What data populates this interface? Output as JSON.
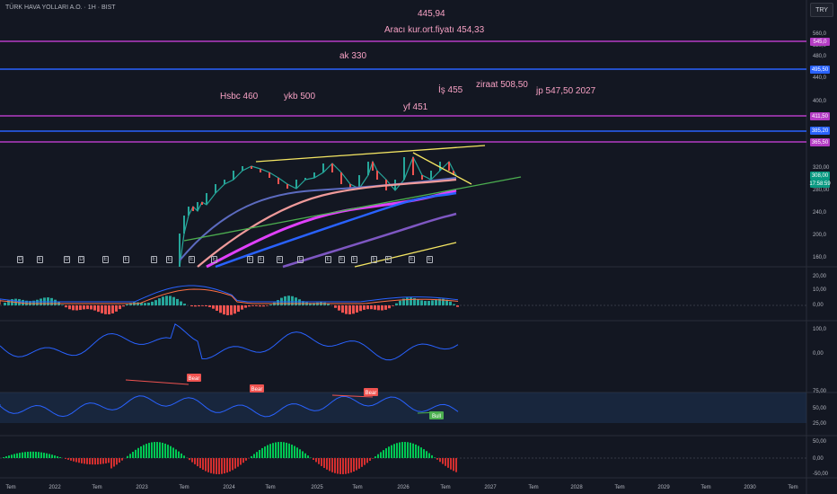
{
  "header": {
    "symbol": "TÜRK HAVA YOLLARI A.O. · 1H · BIST",
    "currency": "TRY"
  },
  "annotations": [
    {
      "text": "445,94"
    },
    {
      "text": "Aracı kur.ort.fiyatı 454,33"
    },
    {
      "text": "ak 330"
    },
    {
      "text": "Hsbc 460"
    },
    {
      "text": "ykb 500"
    },
    {
      "text": "İş 455"
    },
    {
      "text": "ziraat 508,50"
    },
    {
      "text": "jp 547,50 2027"
    },
    {
      "text": "yf 451"
    }
  ],
  "price_labels": [
    {
      "text": "545,0",
      "color": "#b43cc4"
    },
    {
      "text": "495,50",
      "color": "#2962ff"
    },
    {
      "text": "411,50",
      "color": "#b43cc4"
    },
    {
      "text": "385,20",
      "color": "#2962ff"
    },
    {
      "text": "365,50",
      "color": "#b43cc4"
    },
    {
      "text": "308,00",
      "color": "#089981"
    },
    {
      "text": "17:58:59",
      "color": "#089981"
    }
  ],
  "colors": {
    "magenta": "#b43cc4",
    "blue": "#2962ff",
    "yellow": "#f5e663",
    "green": "#4caf50",
    "bg": "#131722"
  },
  "chart_data": [
    {
      "type": "line",
      "name": "price",
      "y_ticks": [
        "560,0",
        "520,0",
        "480,0",
        "440,0",
        "400,0",
        "320,00",
        "280,00",
        "240,0",
        "200,0",
        "160,0"
      ],
      "horizontal_lines": [
        545.0,
        495.5,
        411.5,
        385.2,
        365.5
      ],
      "x": [
        "2022",
        "2022-07",
        "2023",
        "2023-07",
        "2024",
        "2024-07",
        "2025",
        "2025-07",
        "2026",
        "2026-07"
      ],
      "series": [
        {
          "values": [
            140,
            150,
            170,
            260,
            305,
            300,
            305,
            320,
            315,
            310
          ]
        }
      ],
      "last": 308.0
    },
    {
      "type": "bar",
      "name": "macd",
      "y_ticks": [
        "20,00",
        "10,00",
        "0,00"
      ]
    },
    {
      "type": "line",
      "name": "osc2",
      "y_ticks": [
        "100,0",
        "0,00"
      ]
    },
    {
      "type": "line",
      "name": "rsi",
      "y_ticks": [
        "75,00",
        "50,00",
        "25,00"
      ],
      "divergence_labels": [
        "Bear",
        "Bear",
        "Bear",
        "Bull"
      ]
    },
    {
      "type": "bar",
      "name": "momentum",
      "y_ticks": [
        "50,00",
        "0,00",
        "-50,00"
      ]
    }
  ],
  "x_axis": [
    "Tem",
    "2022",
    "Tem",
    "2023",
    "Tem",
    "2024",
    "Tem",
    "2025",
    "Tem",
    "2026",
    "Tem",
    "2027",
    "Tem",
    "2028",
    "Tem",
    "2029",
    "Tem",
    "2030",
    "Tem"
  ],
  "events": [
    "D",
    "E",
    "D",
    "D",
    "E",
    "E",
    "E",
    "E",
    "E",
    "E",
    "E",
    "E",
    "E",
    "E",
    "E",
    "E",
    "E",
    "E",
    "E",
    "E",
    "E"
  ]
}
